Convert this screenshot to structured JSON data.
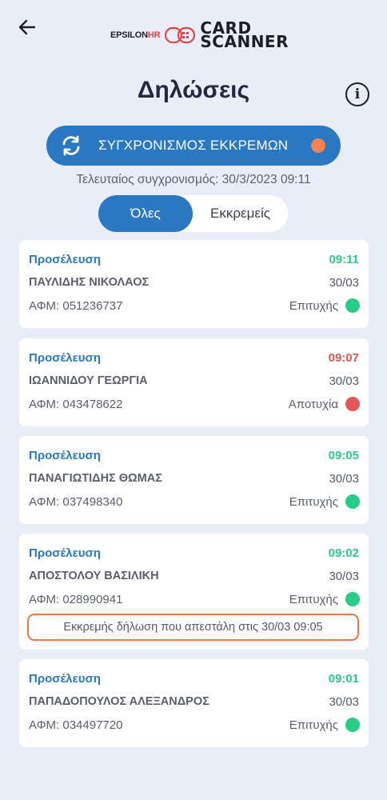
{
  "header": {
    "logo_brand": "EPSILON",
    "logo_brand_suffix": "HR",
    "logo_product_line1": "CARD",
    "logo_product_line2": "SCANNER"
  },
  "page": {
    "title": "Δηλώσεις"
  },
  "sync": {
    "button_label": "ΣΥΓΧΡΟΝΙΣΜΟΣ ΕΚΚΡΕΜΩΝ",
    "last_sync_text": "Τελευταίος συγχρονισμός: 30/3/2023 09:11",
    "pending_color": "#f4834f"
  },
  "filter_tabs": [
    {
      "label": "Όλες",
      "selected": true
    },
    {
      "label": "Εκκρεμείς",
      "selected": false
    }
  ],
  "colors": {
    "accent": "#2a78c2",
    "success": "#27cd86",
    "failure": "#e25757",
    "time_ok": "#2fc78a",
    "time_fail": "#dd5a54"
  },
  "declarations": [
    {
      "type": "Προσέλευση",
      "time": "09:11",
      "name": "ΠΑΥΛΙΔΗΣ ΝΙΚΟΛΑΟΣ",
      "date": "30/03",
      "afm": "ΑΦΜ: 051236737",
      "status": "Επιτυχής",
      "ok": true
    },
    {
      "type": "Προσέλευση",
      "time": "09:07",
      "name": "ΙΩΑΝΝΙΔΟΥ ΓΕΩΡΓΙΑ",
      "date": "30/03",
      "afm": "ΑΦΜ: 043478622",
      "status": "Αποτυχία",
      "ok": false
    },
    {
      "type": "Προσέλευση",
      "time": "09:05",
      "name": "ΠΑΝΑΓΙΩΤΙΔΗΣ ΘΩΜΑΣ",
      "date": "30/03",
      "afm": "ΑΦΜ: 037498340",
      "status": "Επιτυχής",
      "ok": true
    },
    {
      "type": "Προσέλευση",
      "time": "09:02",
      "name": "ΑΠΟΣΤΟΛΟΥ ΒΑΣΙΛΙΚΗ",
      "date": "30/03",
      "afm": "ΑΦΜ: 028990941",
      "status": "Επιτυχής",
      "ok": true,
      "note": "Εκκρεμής δήλωση που απεστάλη στις 30/03 09:05"
    },
    {
      "type": "Προσέλευση",
      "time": "09:01",
      "name": "ΠΑΠΑΔΟΠΟΥΛΟΣ ΑΛΕΞΑΝΔΡΟΣ",
      "date": "30/03",
      "afm": "ΑΦΜ: 034497720",
      "status": "Επιτυχής",
      "ok": true
    }
  ]
}
